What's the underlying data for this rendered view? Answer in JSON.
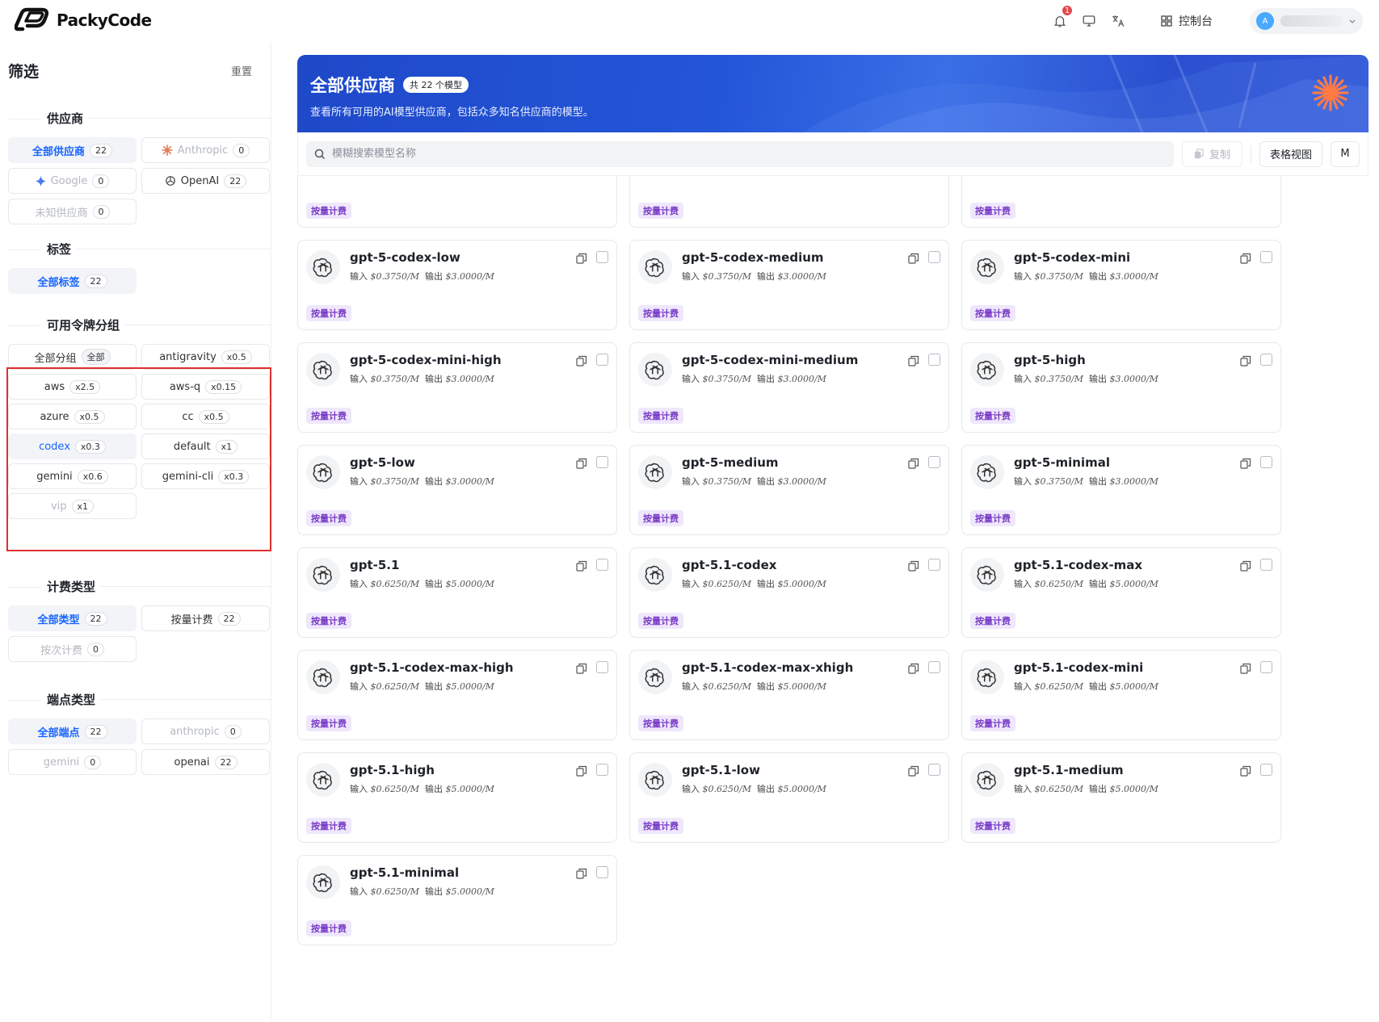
{
  "app": {
    "brand": "PackyCode"
  },
  "header": {
    "notification_count": "1",
    "console_label": "控制台",
    "avatar_letter": "A"
  },
  "sidebar": {
    "title": "筛选",
    "reset_label": "重置",
    "providers": {
      "title": "供应商",
      "items": [
        {
          "label": "全部供应商",
          "count": "22"
        },
        {
          "label": "Anthropic",
          "count": "0"
        },
        {
          "label": "Google",
          "count": "0"
        },
        {
          "label": "OpenAI",
          "count": "22"
        },
        {
          "label": "未知供应商",
          "count": "0"
        }
      ]
    },
    "tags": {
      "title": "标签",
      "items": [
        {
          "label": "全部标签",
          "count": "22"
        }
      ]
    },
    "groups": {
      "title": "可用令牌分组",
      "items": [
        {
          "label": "全部分组",
          "ratio": "全部"
        },
        {
          "label": "antigravity",
          "ratio": "x0.5"
        },
        {
          "label": "aws",
          "ratio": "x2.5"
        },
        {
          "label": "aws-q",
          "ratio": "x0.15"
        },
        {
          "label": "azure",
          "ratio": "x0.5"
        },
        {
          "label": "cc",
          "ratio": "x0.5"
        },
        {
          "label": "codex",
          "ratio": "x0.3"
        },
        {
          "label": "default",
          "ratio": "x1"
        },
        {
          "label": "gemini",
          "ratio": "x0.6"
        },
        {
          "label": "gemini-cli",
          "ratio": "x0.3"
        },
        {
          "label": "vip",
          "ratio": "x1"
        }
      ]
    },
    "billing": {
      "title": "计费类型",
      "items": [
        {
          "label": "全部类型",
          "count": "22"
        },
        {
          "label": "按量计费",
          "count": "22"
        },
        {
          "label": "按次计费",
          "count": "0"
        }
      ]
    },
    "endpoints": {
      "title": "端点类型",
      "items": [
        {
          "label": "全部端点",
          "count": "22"
        },
        {
          "label": "anthropic",
          "count": "0"
        },
        {
          "label": "gemini",
          "count": "0"
        },
        {
          "label": "openai",
          "count": "22"
        }
      ]
    }
  },
  "banner": {
    "title": "全部供应商",
    "total_label": "共 22 个模型",
    "description": "查看所有可用的AI模型供应商，包括众多知名供应商的模型。"
  },
  "toolbar": {
    "search_placeholder": "模糊搜索模型名称",
    "copy_label": "复制",
    "table_view_label": "表格视图",
    "m_label": "M"
  },
  "models": [
    {
      "name": "",
      "input": "",
      "output": "",
      "tag": "按量计费"
    },
    {
      "name": "",
      "input": "",
      "output": "",
      "tag": "按量计费"
    },
    {
      "name": "",
      "input": "",
      "output": "",
      "tag": "按量计费"
    },
    {
      "name": "gpt-5-codex-low",
      "input": "$0.3750/M",
      "output": "$3.0000/M",
      "tag": "按量计费"
    },
    {
      "name": "gpt-5-codex-medium",
      "input": "$0.3750/M",
      "output": "$3.0000/M",
      "tag": "按量计费"
    },
    {
      "name": "gpt-5-codex-mini",
      "input": "$0.3750/M",
      "output": "$3.0000/M",
      "tag": "按量计费"
    },
    {
      "name": "gpt-5-codex-mini-high",
      "input": "$0.3750/M",
      "output": "$3.0000/M",
      "tag": "按量计费"
    },
    {
      "name": "gpt-5-codex-mini-medium",
      "input": "$0.3750/M",
      "output": "$3.0000/M",
      "tag": "按量计费"
    },
    {
      "name": "gpt-5-high",
      "input": "$0.3750/M",
      "output": "$3.0000/M",
      "tag": "按量计费"
    },
    {
      "name": "gpt-5-low",
      "input": "$0.3750/M",
      "output": "$3.0000/M",
      "tag": "按量计费"
    },
    {
      "name": "gpt-5-medium",
      "input": "$0.3750/M",
      "output": "$3.0000/M",
      "tag": "按量计费"
    },
    {
      "name": "gpt-5-minimal",
      "input": "$0.3750/M",
      "output": "$3.0000/M",
      "tag": "按量计费"
    },
    {
      "name": "gpt-5.1",
      "input": "$0.6250/M",
      "output": "$5.0000/M",
      "tag": "按量计费"
    },
    {
      "name": "gpt-5.1-codex",
      "input": "$0.6250/M",
      "output": "$5.0000/M",
      "tag": "按量计费"
    },
    {
      "name": "gpt-5.1-codex-max",
      "input": "$0.6250/M",
      "output": "$5.0000/M",
      "tag": "按量计费"
    },
    {
      "name": "gpt-5.1-codex-max-high",
      "input": "$0.6250/M",
      "output": "$5.0000/M",
      "tag": "按量计费"
    },
    {
      "name": "gpt-5.1-codex-max-xhigh",
      "input": "$0.6250/M",
      "output": "$5.0000/M",
      "tag": "按量计费"
    },
    {
      "name": "gpt-5.1-codex-mini",
      "input": "$0.6250/M",
      "output": "$5.0000/M",
      "tag": "按量计费"
    },
    {
      "name": "gpt-5.1-high",
      "input": "$0.6250/M",
      "output": "$5.0000/M",
      "tag": "按量计费"
    },
    {
      "name": "gpt-5.1-low",
      "input": "$0.6250/M",
      "output": "$5.0000/M",
      "tag": "按量计费"
    },
    {
      "name": "gpt-5.1-medium",
      "input": "$0.6250/M",
      "output": "$5.0000/M",
      "tag": "按量计费"
    },
    {
      "name": "gpt-5.1-minimal",
      "input": "$0.6250/M",
      "output": "$5.0000/M",
      "tag": "按量计费"
    }
  ],
  "labels": {
    "input_prefix": "输入",
    "output_prefix": "输出"
  },
  "colors": {
    "accent": "#1664ff",
    "banner": "#2456d8",
    "tag": "#7a3ec7",
    "highlight_box": "#e02e2e"
  }
}
